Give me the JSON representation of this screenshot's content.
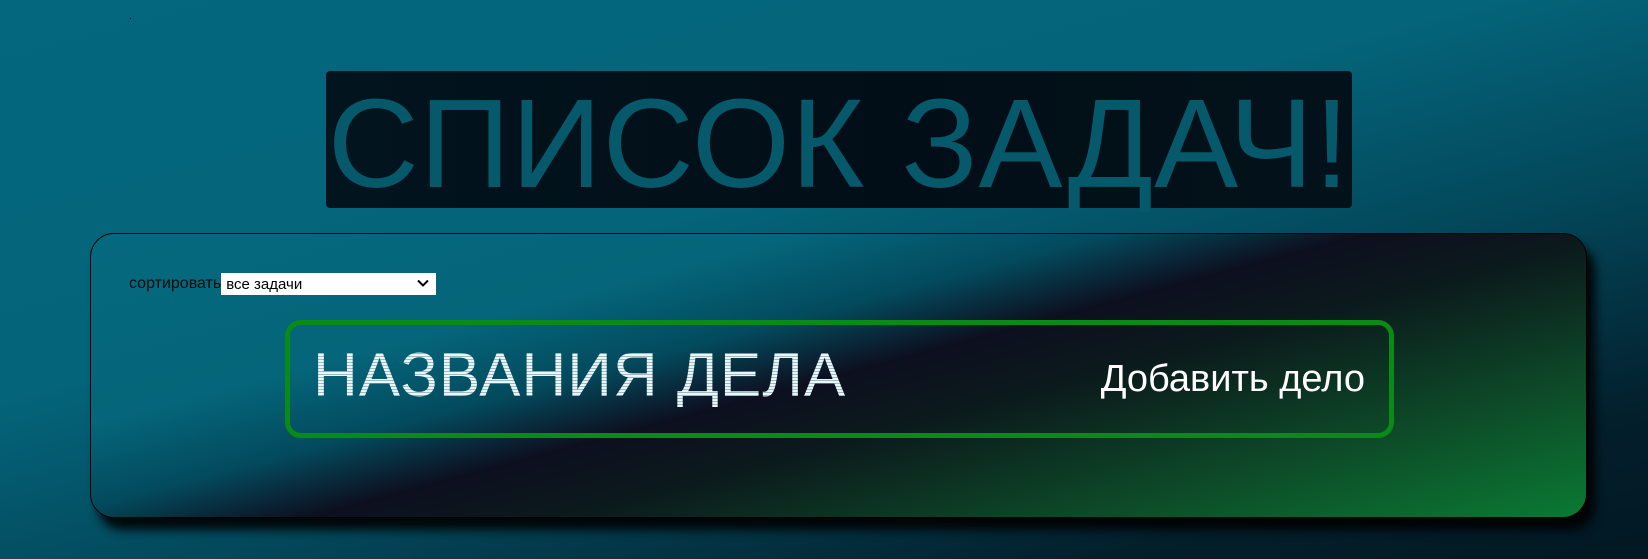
{
  "header": {
    "title": "СПИСОК ЗАДАЧ!"
  },
  "sort": {
    "label": "сортировать",
    "selected": "все задачи"
  },
  "task_form": {
    "input_text": "НАЗВАНИЯ ДЕЛА",
    "add_button_label": "Добавить дело"
  },
  "colors": {
    "background": "#04677d",
    "title_text": "#05596b",
    "title_box": "#020e17",
    "task_border": "#0a8a16",
    "add_button_text": "#ffffff"
  },
  "icons": {
    "select_arrow": "chevron-down-icon"
  }
}
